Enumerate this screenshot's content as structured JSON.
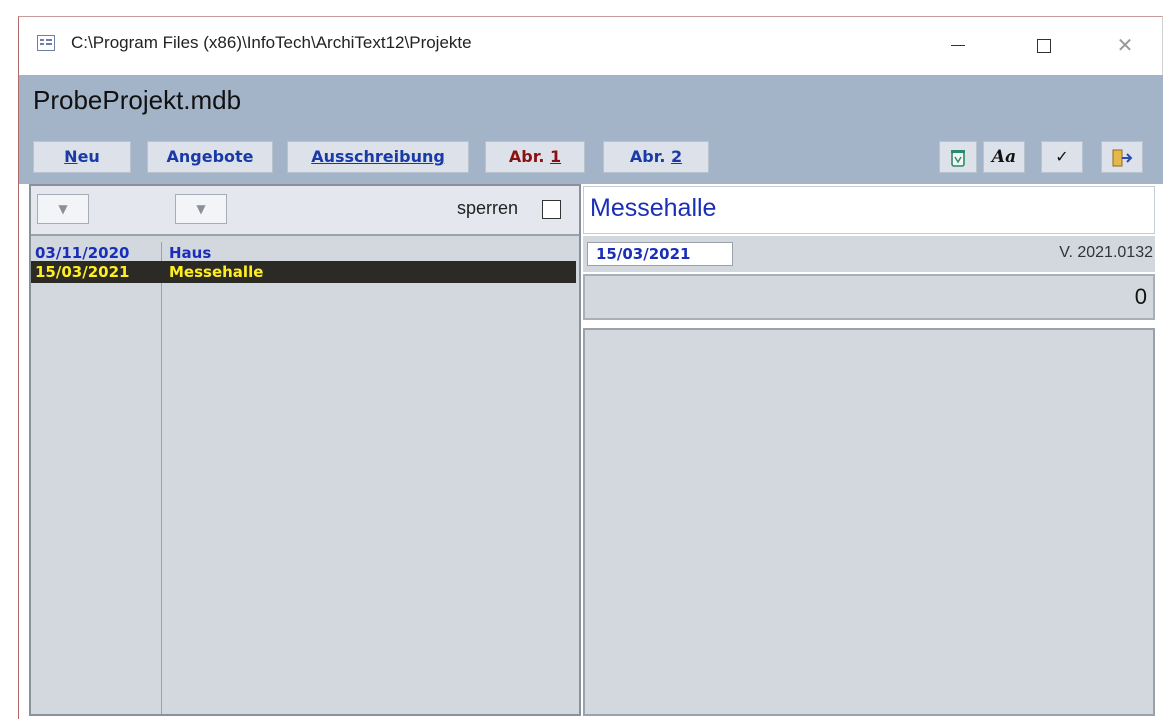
{
  "window": {
    "title": "C:\\Program Files (x86)\\InfoTech\\ArchiText12\\Projekte",
    "controls": {
      "minimize": "minimize",
      "maximize": "maximize",
      "close": "✕"
    }
  },
  "app": {
    "title": "ProbeProjekt.mdb"
  },
  "toolbar": {
    "neu": {
      "underlined": "N",
      "rest": "eu"
    },
    "angebote": "Angebote",
    "ausschreibung": {
      "underlined": "A",
      "rest": "usschreibung"
    },
    "abr1": {
      "prefix": "Abr. ",
      "underlined": "1"
    },
    "abr2": {
      "prefix": "Abr. ",
      "underlined": "2"
    },
    "icons": [
      "trash-icon",
      "font-icon",
      "check-icon",
      "exit-door-icon"
    ],
    "font_glyph": "Aa",
    "check_glyph": "✓"
  },
  "filter": {
    "dropdown_glyph": "▼",
    "lock_label": "sperren",
    "lock_checked": false
  },
  "projects": [
    {
      "date": "03/11/2020",
      "name": "Haus",
      "selected": false
    },
    {
      "date": "15/03/2021",
      "name": "Messehalle",
      "selected": true
    }
  ],
  "detail": {
    "name": "Messehalle",
    "date": "15/03/2021",
    "version": "V. 2021.0132",
    "count": "0",
    "notes": ""
  },
  "colors": {
    "app_background": "#a3b3c8",
    "link_blue": "#1a2fb8",
    "selected_row_bg": "#2b2a24",
    "selected_row_text": "#ffee22",
    "abr1_red": "#8b1111"
  }
}
